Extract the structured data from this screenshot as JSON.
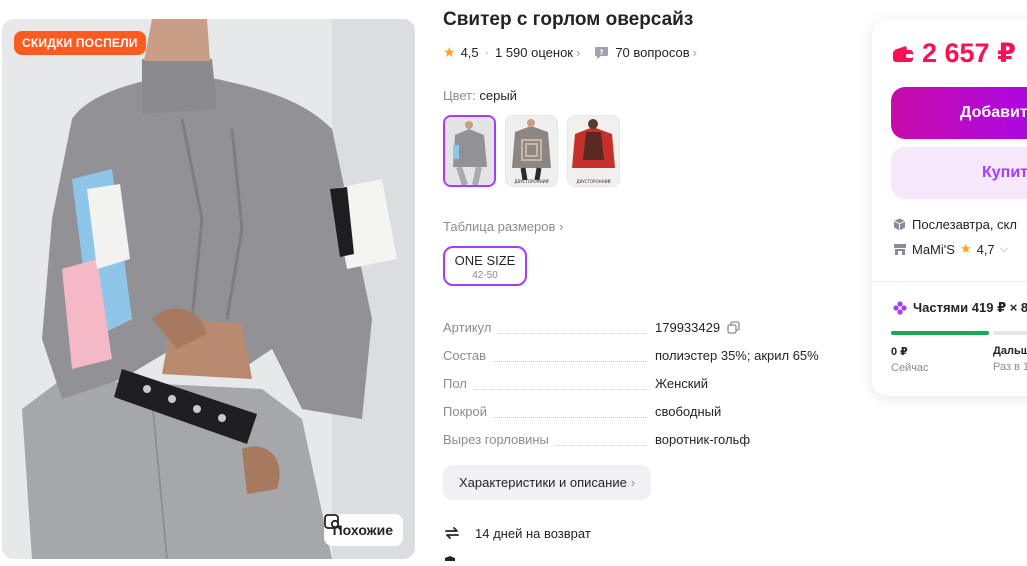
{
  "product": {
    "title": "Свитер с горлом оверсайз",
    "rating": "4,5",
    "reviews": "1 590 оценок",
    "questions": "70 вопросов",
    "color_label": "Цвет:",
    "color_value": "серый",
    "swatch_caption": "ДВУСТОРОННИЙ",
    "size_table_label": "Таблица размеров",
    "size": {
      "label": "ONE SIZE",
      "sub": "42-50"
    },
    "specs": [
      {
        "key": "Артикул",
        "value": "179933429"
      },
      {
        "key": "Состав",
        "value": "полиэстер 35%; акрил 65%"
      },
      {
        "key": "Пол",
        "value": "Женский"
      },
      {
        "key": "Покрой",
        "value": "свободный"
      },
      {
        "key": "Вырез горловины",
        "value": "воротник-гольф"
      }
    ],
    "desc_button": "Характеристики и описание",
    "return_text": "14 дней на возврат"
  },
  "gallery": {
    "badge": "СКИДКИ ПОСПЕЛИ",
    "similar_button": "Похожие"
  },
  "buy_card": {
    "price": "2 657 ₽",
    "add_button": "Добавит",
    "buy_button": "Купит",
    "delivery": "Послезавтра, скл",
    "seller": "MaMi'S",
    "seller_rating": "4,7",
    "installments": "Частями 419 ₽ × 8",
    "steps": [
      {
        "amount": "0 ₽",
        "label": "Сейчас"
      },
      {
        "amount": "Дальш",
        "label": "Раз в 1"
      }
    ]
  },
  "colors": {
    "accent": "#a73afd",
    "price": "#f91155",
    "sale_badge": "#ff5a1f",
    "primary_button": "#cb11ab",
    "rating_star": "#ffa41b",
    "progress": "#15ab55"
  },
  "icons": [
    "star-icon",
    "question-bubble-icon",
    "copy-icon",
    "return-arrows-icon",
    "wallet-icon",
    "box-icon",
    "shop-icon",
    "installment-icon",
    "similar-search-icon"
  ]
}
